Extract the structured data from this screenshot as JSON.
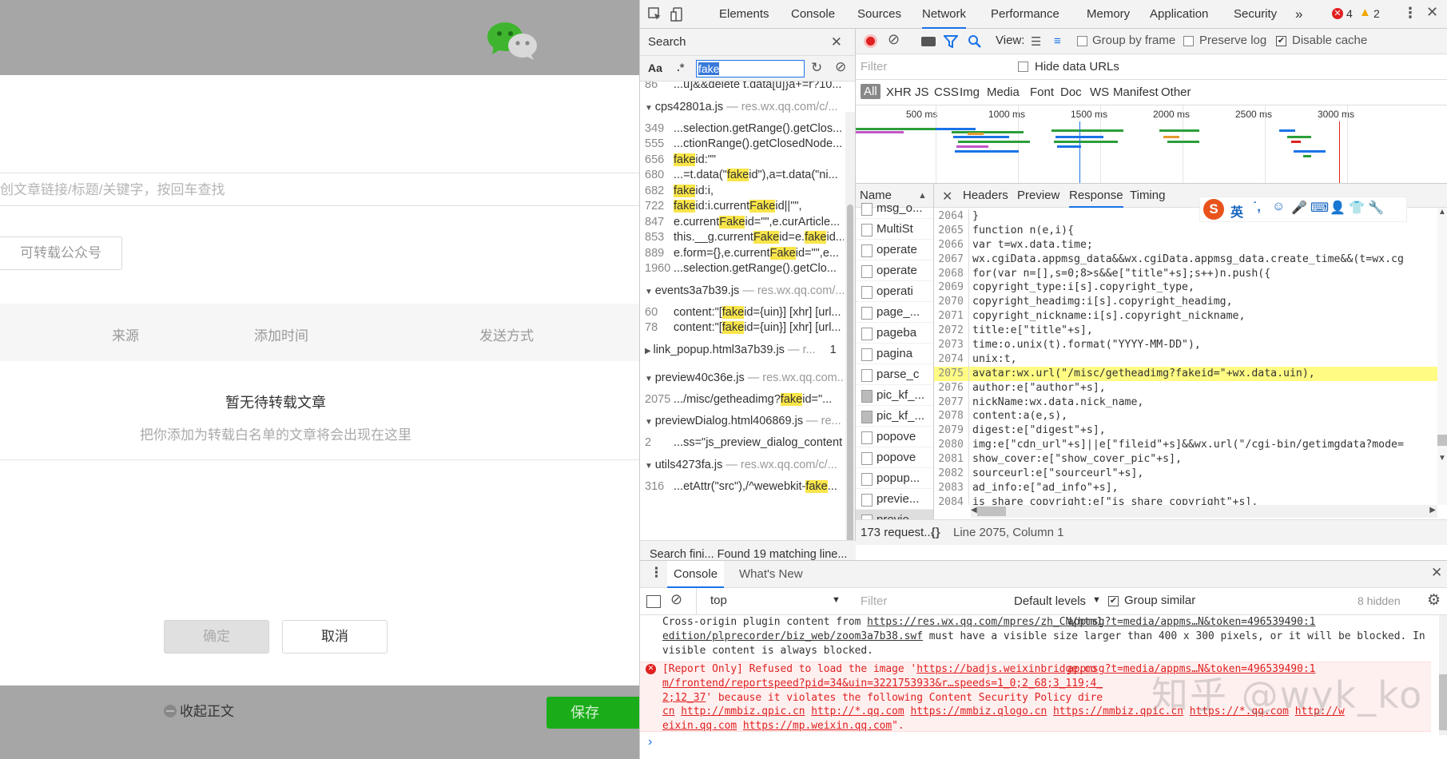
{
  "left_panel": {
    "search_placeholder": "创文章链接/标题/关键字，按回车查找",
    "account_button": "可转载公众号",
    "table_headers": [
      "来源",
      "添加时间",
      "发送方式"
    ],
    "empty_title": "暂无待转载文章",
    "empty_subtitle": "把你添加为转载白名单的文章将会出现在这里",
    "confirm_button": "确定",
    "cancel_button": "取消",
    "collapse_label": "收起正文",
    "save_button": "保存"
  },
  "devtools": {
    "tabs": [
      "Elements",
      "Console",
      "Sources",
      "Network",
      "Performance",
      "Memory",
      "Application",
      "Security"
    ],
    "active_tab": "Network",
    "more_tabs": "»",
    "error_count": "4",
    "warning_count": "2",
    "search_panel": {
      "title": "Search",
      "match_case": "Aa",
      "regex": ".*",
      "query": "fake",
      "results": [
        {
          "type": "line",
          "num": "86",
          "text": "...u]&&delete t.data[u]}a+=r?10..."
        },
        {
          "type": "file",
          "name": "cps42801a.js",
          "url": "— res.wx.qq.com/c/..."
        },
        {
          "type": "line",
          "num": "349",
          "text": "...selection.getRange().getClos..."
        },
        {
          "type": "line",
          "num": "555",
          "text": "...ctionRange().getClosedNode..."
        },
        {
          "type": "line",
          "num": "656",
          "pre": "",
          "hl": "fake",
          "post": "id:\"\""
        },
        {
          "type": "line",
          "num": "680",
          "pre": "...=t.data(\"",
          "hl": "fake",
          "post": "id\"),a=t.data(\"ni..."
        },
        {
          "type": "line",
          "num": "682",
          "pre": "",
          "hl": "fake",
          "post": "id:i,"
        },
        {
          "type": "line",
          "num": "722",
          "pre": "",
          "hl": "fake",
          "post": "id:i.current",
          "hl2": "Fake",
          "post2": "id||\"\","
        },
        {
          "type": "line",
          "num": "847",
          "pre": "e.current",
          "hl": "Fake",
          "post": "id=\"\",e.curArticle..."
        },
        {
          "type": "line",
          "num": "853",
          "pre": "this.__g.current",
          "hl": "Fake",
          "post": "id=e.",
          "hl2": "fake",
          "post2": "id..."
        },
        {
          "type": "line",
          "num": "889",
          "pre": "e.form={},e.current",
          "hl": "Fake",
          "post": "id=\"\",e..."
        },
        {
          "type": "line",
          "num": "1960",
          "text": "...selection.getRange().getClo..."
        },
        {
          "type": "file",
          "name": "events3a7b39.js",
          "url": "— res.wx.qq.com/..."
        },
        {
          "type": "line",
          "num": "60",
          "pre": "content:\"[",
          "hl": "fake",
          "post": "id={uin}] [xhr] [url..."
        },
        {
          "type": "line",
          "num": "78",
          "pre": "content:\"[",
          "hl": "fake",
          "post": "id={uin}] [xhr] [url..."
        },
        {
          "type": "file",
          "name": "link_popup.html3a7b39.js",
          "url": "— r...",
          "count": "1",
          "collapsed": true
        },
        {
          "type": "file",
          "name": "preview40c36e.js",
          "url": "— res.wx.qq.com..."
        },
        {
          "type": "line",
          "num": "2075",
          "pre": ".../misc/getheadimg?",
          "hl": "fake",
          "post": "id=\"..."
        },
        {
          "type": "file",
          "name": "previewDialog.html406869.js",
          "url": "— re..."
        },
        {
          "type": "line",
          "num": "2",
          "text": "...ss=\"js_preview_dialog_content ..."
        },
        {
          "type": "file",
          "name": "utils4273fa.js",
          "url": "— res.wx.qq.com/c/..."
        },
        {
          "type": "line",
          "num": "316",
          "pre": "...etAttr(\"src\"),/^wewebkit-",
          "hl": "fake",
          "post": "..."
        }
      ],
      "status": "Search fini...  Found 19 matching line..."
    },
    "network": {
      "view_label": "View:",
      "group_by_frame": "Group by frame",
      "preserve_log": "Preserve log",
      "disable_cache": "Disable cache",
      "filter_placeholder": "Filter",
      "hide_data_urls": "Hide data URLs",
      "types": [
        "All",
        "XHR",
        "JS",
        "CSS",
        "Img",
        "Media",
        "Font",
        "Doc",
        "WS",
        "Manifest",
        "Other"
      ],
      "timeline_labels": [
        "500 ms",
        "1000 ms",
        "1500 ms",
        "2000 ms",
        "2500 ms",
        "3000 ms"
      ],
      "name_header": "Name",
      "names": [
        "msg_o...",
        "MultiSt",
        "operate",
        "operate",
        "operati",
        "page_...",
        "pageba",
        "pagina",
        "parse_c",
        "pic_kf_...",
        "pic_kf_...",
        "popove",
        "popove",
        "popup...",
        "previe...",
        "previe..."
      ],
      "detail_tabs": [
        "Headers",
        "Preview",
        "Response",
        "Timing"
      ],
      "active_detail_tab": "Response",
      "code_lines": [
        {
          "n": "2064",
          "t": "}"
        },
        {
          "n": "2065",
          "t": "function n(e,i){"
        },
        {
          "n": "2066",
          "t": "var t=wx.data.time;"
        },
        {
          "n": "2067",
          "t": "wx.cgiData.appmsg_data&&wx.cgiData.appmsg_data.create_time&&(t=wx.cg"
        },
        {
          "n": "2068",
          "t": "for(var n=[],s=0;8>s&&e[\"title\"+s];s++)n.push({"
        },
        {
          "n": "2069",
          "t": "copyright_type:i[s].copyright_type,"
        },
        {
          "n": "2070",
          "t": "copyright_headimg:i[s].copyright_headimg,"
        },
        {
          "n": "2071",
          "t": "copyright_nickname:i[s].copyright_nickname,"
        },
        {
          "n": "2072",
          "t": "title:e[\"title\"+s],"
        },
        {
          "n": "2073",
          "t": "time:o.unix(t).format(\"YYYY-MM-DD\"),"
        },
        {
          "n": "2074",
          "t": "unix:t,"
        },
        {
          "n": "2075",
          "t": "avatar:wx.url(\"/misc/getheadimg?fakeid=\"+wx.data.uin),"
        },
        {
          "n": "2076",
          "t": "author:e[\"author\"+s],"
        },
        {
          "n": "2077",
          "t": "nickName:wx.data.nick_name,"
        },
        {
          "n": "2078",
          "t": "content:a(e,s),"
        },
        {
          "n": "2079",
          "t": "digest:e[\"digest\"+s],"
        },
        {
          "n": "2080",
          "t": "img:e[\"cdn_url\"+s]||e[\"fileid\"+s]&&wx.url(\"/cgi-bin/getimgdata?mode="
        },
        {
          "n": "2081",
          "t": "show_cover:e[\"show_cover_pic\"+s],"
        },
        {
          "n": "2082",
          "t": "sourceurl:e[\"sourceurl\"+s],"
        },
        {
          "n": "2083",
          "t": "ad_info:e[\"ad_info\"+s],"
        },
        {
          "n": "2084",
          "t": "is_share_copyright:e[\"is_share_copyright\"+s],"
        },
        {
          "n": "2085",
          "t": ""
        }
      ],
      "request_count": "173 request...",
      "cursor_position": "Line 2075, Column 1",
      "pretty_print": "{}"
    },
    "ime_label": "英",
    "console": {
      "tabs": [
        "Console",
        "What's New"
      ],
      "context": "top",
      "filter_placeholder": "Filter",
      "levels": "Default levels",
      "group_similar": "Group similar",
      "hidden_count": "8 hidden",
      "msg1_pre": "Cross-origin plugin content from ",
      "msg1_link": "https://res.wx.qq.com/mpres/zh_CN/htm1",
      "msg1_src": "appmsg?t=media/appms…N&token=496539490:1",
      "msg1_link2": "edition/plprecorder/biz_web/zoom3a7b38.swf",
      "msg1_post": " must have a visible size larger than 400 x 300 pixels, or it will be blocked. Invisible content is always blocked.",
      "msg2_pre": "[Report Only] Refused to load the image '",
      "msg2_link": "https://badjs.weixinbridge.co",
      "msg2_src": "appmsg?t=media/appms…N&token=496539490:1",
      "msg2_url": "m/frontend/reportspeed?pid=34&uin=3221753933&r…speeds=1_0;2_68;3_119;4_",
      "msg2_url2": "2;12_37",
      "msg2_mid": "' because it violates the following Content Security Policy dire",
      "msg2_links": [
        "cn",
        "http://mmbiz.qpic.cn",
        "http://*.qq.com",
        "https://mmbiz.qlogo.cn",
        "https://mmbiz.qpic.cn",
        "https://*.qq.com",
        "http://w",
        "eixin.qq.com",
        "https://mp.weixin.qq.com"
      ],
      "prompt": "›"
    },
    "watermark": "知乎 @wyk_ko"
  },
  "colors": {
    "accent": "#1a73e8",
    "highlight": "#f9e549",
    "error_red": "#e02020",
    "save_green": "#1aad19"
  }
}
